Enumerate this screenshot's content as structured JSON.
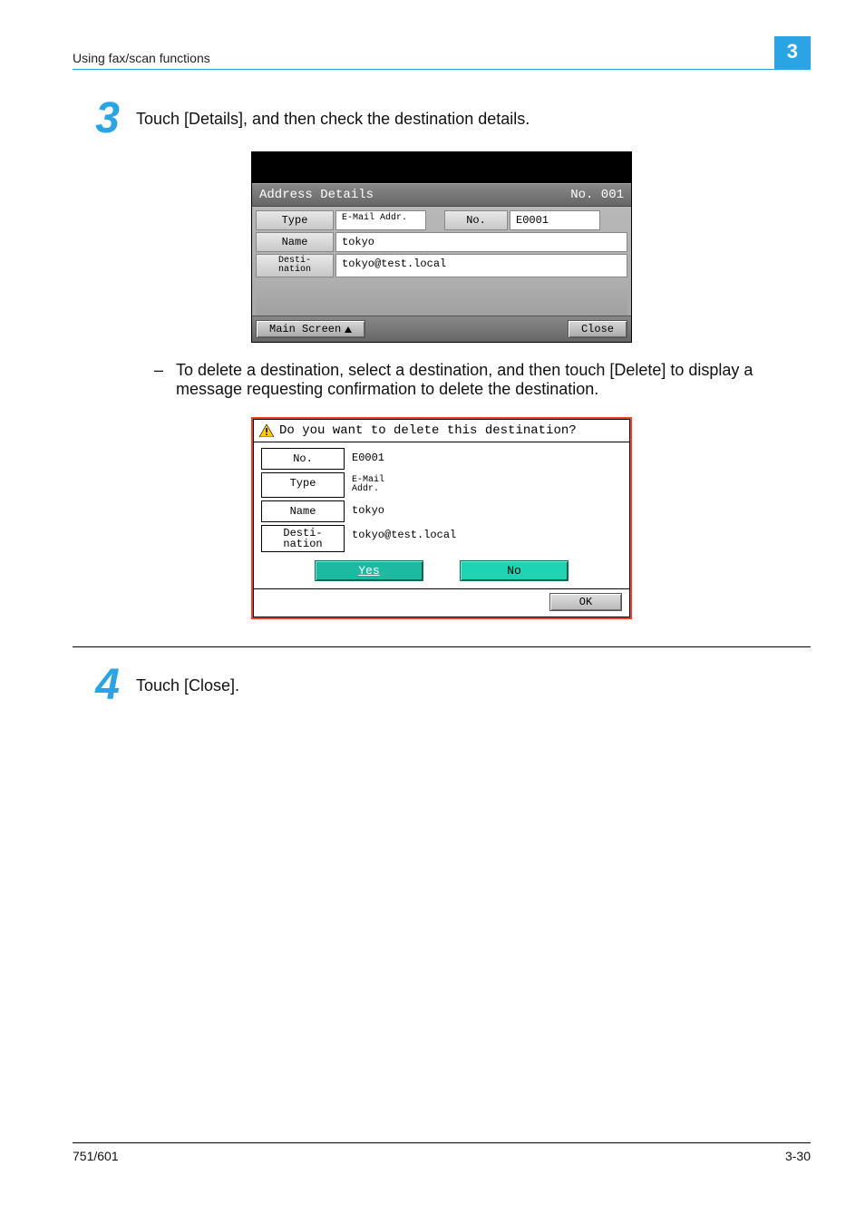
{
  "header": {
    "title": "Using fax/scan functions",
    "chapter": "3"
  },
  "step3": {
    "num": "3",
    "text": "Touch [Details], and then check the destination details."
  },
  "screen1": {
    "title": "Address Details",
    "no_label": "No. 001",
    "type_label": "Type",
    "type_val": "E-Mail\nAddr.",
    "no_field_label": "No.",
    "no_field_val": "E0001",
    "name_label": "Name",
    "name_val": "tokyo",
    "dest_label": "Desti-\nnation",
    "dest_val": "tokyo@test.local",
    "main_screen": "Main Screen",
    "close": "Close"
  },
  "bullet": {
    "dash": "–",
    "text": "To delete a destination, select a destination, and then touch [Delete] to display a message requesting confirmation to delete the destination."
  },
  "screen2": {
    "prompt": "Do you want to delete this destination?",
    "no_label": "No.",
    "no_val": "E0001",
    "type_label": "Type",
    "type_val": "E-Mail\nAddr.",
    "name_label": "Name",
    "name_val": "tokyo",
    "dest_label": "Desti-\nnation",
    "dest_val": "tokyo@test.local",
    "yes": "Yes",
    "no": "No",
    "ok": "OK"
  },
  "step4": {
    "num": "4",
    "text": "Touch [Close]."
  },
  "footer": {
    "left": "751/601",
    "right": "3-30"
  }
}
